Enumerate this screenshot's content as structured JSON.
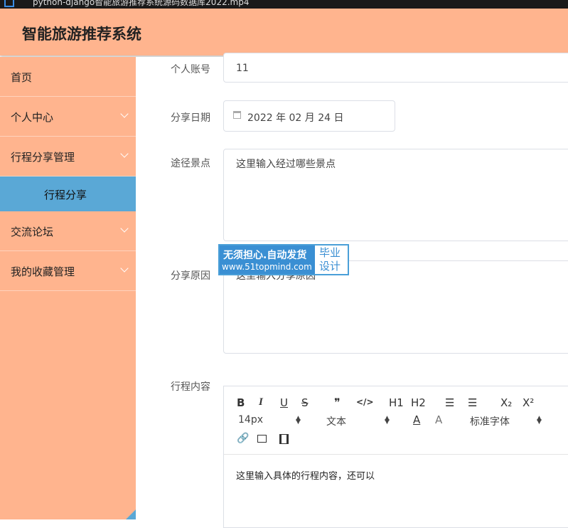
{
  "window": {
    "title": "python-django智能旅游推荐系统源码数据库2022.mp4"
  },
  "header": {
    "app_title": "智能旅游推荐系统"
  },
  "sidebar": {
    "items": [
      {
        "label": "首页"
      },
      {
        "label": "个人中心"
      },
      {
        "label": "行程分享管理"
      },
      {
        "label": "行程分享"
      },
      {
        "label": "交流论坛"
      },
      {
        "label": "我的收藏管理"
      }
    ]
  },
  "form": {
    "account": {
      "label": "个人账号",
      "value": "11"
    },
    "share_date": {
      "label": "分享日期",
      "value": "2022 年 02 月 24 日"
    },
    "spots": {
      "label": "途径景点",
      "placeholder": "这里输入经过哪些景点"
    },
    "reason": {
      "label": "分享原因",
      "placeholder": "这里输入分享原因"
    },
    "content": {
      "label": "行程内容",
      "text": "这里输入具体的行程内容，还可以"
    }
  },
  "editor_toolbar": {
    "bold": "B",
    "italic": "I",
    "underline": "U",
    "strike": "S",
    "quote": "❞",
    "code": "</>",
    "h1": "H1",
    "h2": "H2",
    "ordered_list": "☰",
    "bullet_list": "☰",
    "subscript": "X₂",
    "superscript": "X²",
    "font_size": "14px",
    "header_select": "文本",
    "font_family": "标准字体"
  },
  "watermark": {
    "line1": "无须担心.自动发货",
    "line2": "www.51topmind.com",
    "badge": "毕业设计"
  },
  "colors": {
    "accent": "#ffb48e",
    "active": "#5aa8d6",
    "watermark": "#3a8fd3"
  }
}
